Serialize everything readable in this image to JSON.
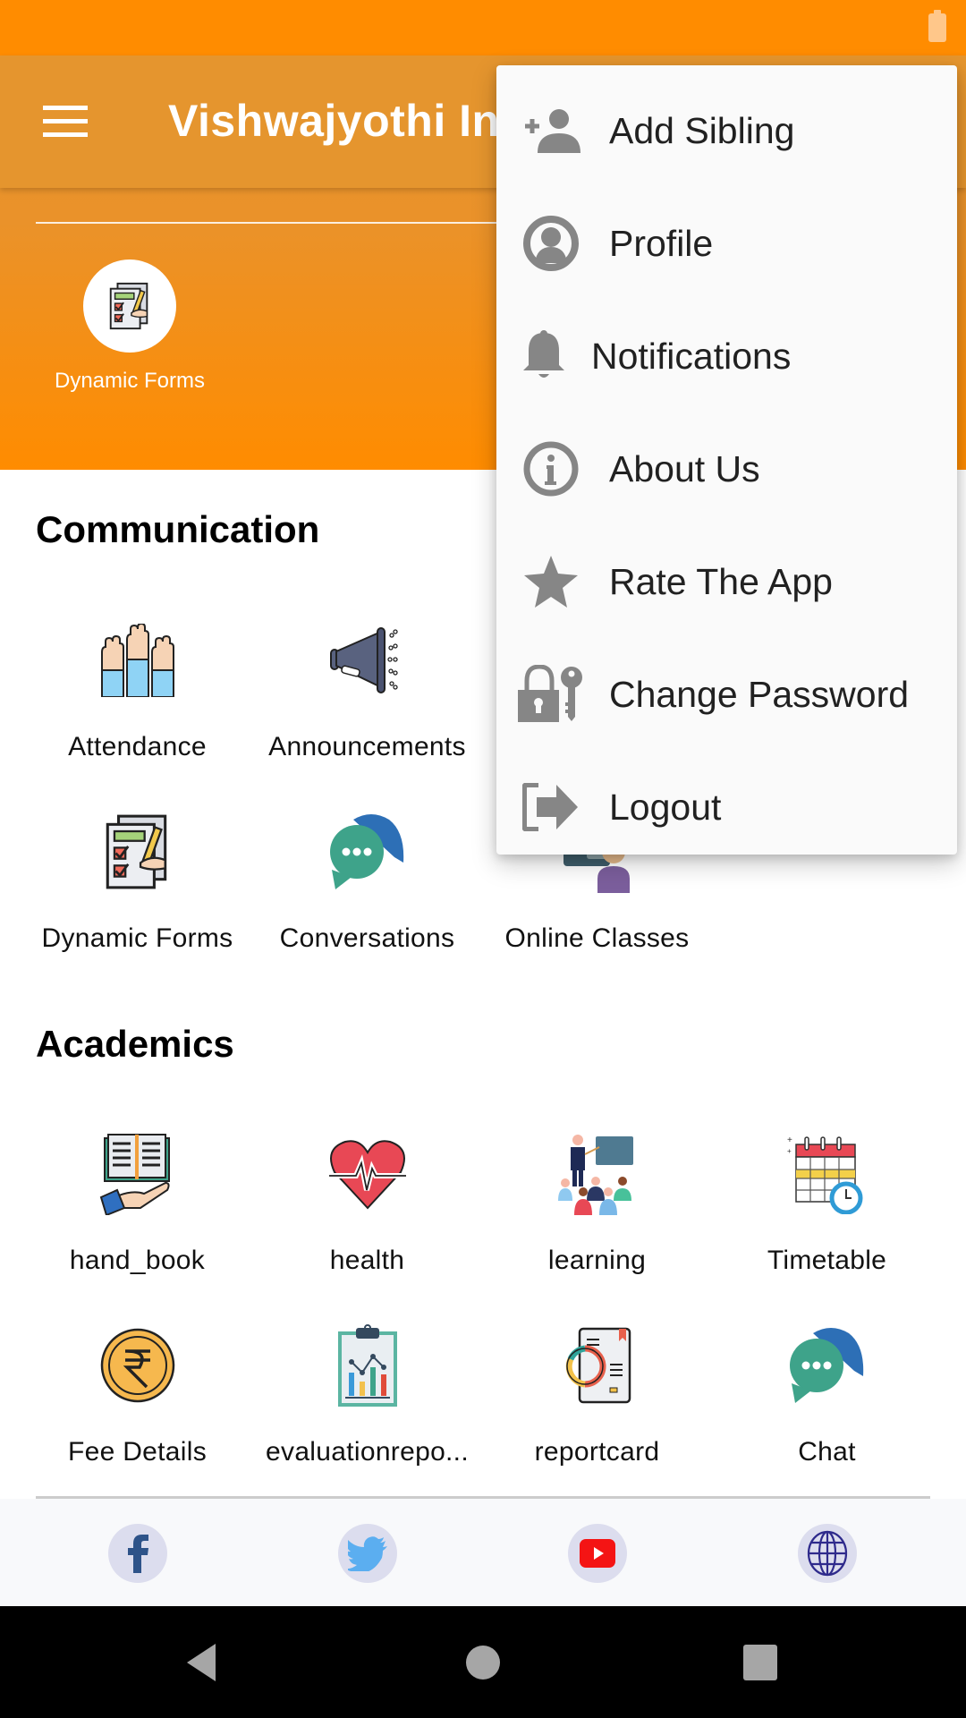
{
  "app": {
    "title": "Vishwajyothi International School",
    "theme_color": "#E5952E",
    "status_bar_color": "#FF8C00"
  },
  "toolbar": {
    "menu_icon": "hamburger-icon",
    "title_visible": "Vishwajyothi Int"
  },
  "header": {
    "quick_access": [
      {
        "label": "Dynamic Forms",
        "icon": "dynamic-forms-icon"
      }
    ]
  },
  "sections": [
    {
      "title": "Communication",
      "items": [
        {
          "label": "Attendance",
          "icon": "raised-hands-icon"
        },
        {
          "label": "Announcements",
          "icon": "megaphone-icon"
        },
        {
          "label": "Dynamic Forms",
          "icon": "dynamic-forms-icon"
        },
        {
          "label": "Conversations",
          "icon": "chat-bubbles-icon"
        },
        {
          "label": "Online Classes",
          "icon": "online-class-icon"
        }
      ]
    },
    {
      "title": "Academics",
      "items": [
        {
          "label": "hand_book",
          "icon": "handbook-icon"
        },
        {
          "label": "health",
          "icon": "heart-pulse-icon"
        },
        {
          "label": "learning",
          "icon": "teacher-class-icon"
        },
        {
          "label": "Timetable",
          "icon": "calendar-clock-icon"
        },
        {
          "label": "Fee Details",
          "icon": "rupee-coin-icon"
        },
        {
          "label": "evaluationrepo...",
          "icon": "clipboard-chart-icon"
        },
        {
          "label": "reportcard",
          "icon": "report-card-icon"
        },
        {
          "label": "Chat",
          "icon": "chat-bubbles-icon"
        }
      ]
    }
  ],
  "social": [
    {
      "name": "facebook",
      "icon": "facebook-icon",
      "color": "#3B5998"
    },
    {
      "name": "twitter",
      "icon": "twitter-icon",
      "color": "#55ACEE"
    },
    {
      "name": "youtube",
      "icon": "youtube-icon",
      "color": "#FF0000"
    },
    {
      "name": "website",
      "icon": "globe-icon",
      "color": "#2E2A8C"
    }
  ],
  "overflow_menu": {
    "items": [
      {
        "label": "Add Sibling",
        "icon": "add-person-icon"
      },
      {
        "label": "Profile",
        "icon": "profile-circle-icon"
      },
      {
        "label": "Notifications",
        "icon": "bell-icon"
      },
      {
        "label": "About Us",
        "icon": "info-icon"
      },
      {
        "label": "Rate The App",
        "icon": "star-icon"
      },
      {
        "label": "Change Password",
        "icon": "lock-key-icon"
      },
      {
        "label": "Logout",
        "icon": "logout-icon"
      }
    ]
  },
  "system_nav": {
    "back": "back-icon",
    "home": "home-icon",
    "recents": "recents-icon"
  }
}
